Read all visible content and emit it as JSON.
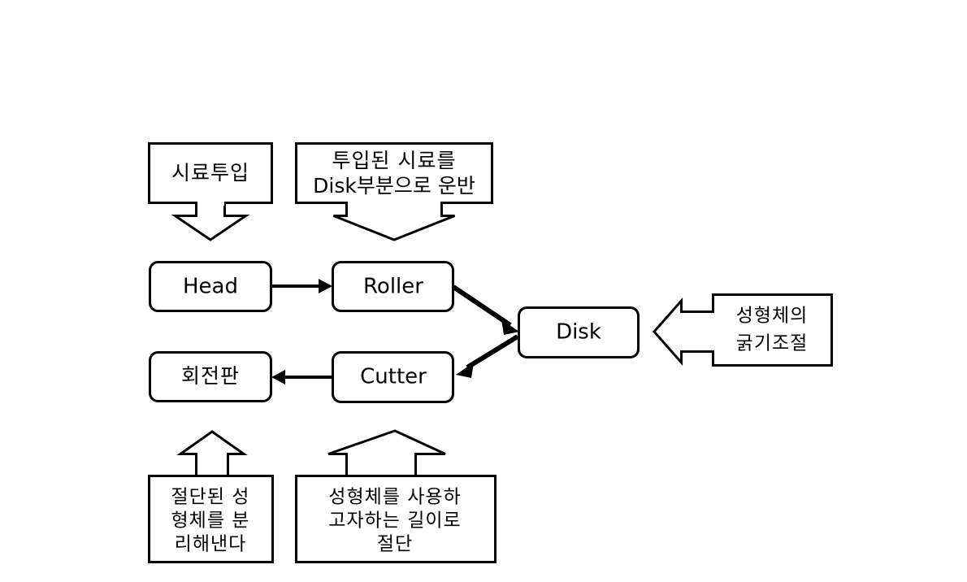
{
  "diagram": {
    "title": "",
    "background_color": "#ffffff",
    "stroke_color": "#000000",
    "nodes": {
      "sample_input": {
        "label": "시료투입"
      },
      "transport": {
        "line1": "투입된 시료를",
        "line2": "Disk부분으로 운반"
      },
      "head": {
        "label": "Head"
      },
      "roller": {
        "label": "Roller"
      },
      "disk": {
        "label": "Disk"
      },
      "cutter": {
        "label": "Cutter"
      },
      "rotating_plate": {
        "label": "회전판"
      },
      "thickness_note": {
        "line1": "성형체의",
        "line2": "굵기조절"
      },
      "separate_note": {
        "line1": "절단된 성",
        "line2": "형체를 분",
        "line3": "리해낸다"
      },
      "cut_note": {
        "line1": "성형체를 사용하",
        "line2": "고자하는 길이로",
        "line3": "절단"
      }
    },
    "connectors": {
      "sample_input_down": "down-block-arrow",
      "transport_down": "down-block-arrow",
      "head_to_roller": "right-line-arrow",
      "roller_to_disk": "diagonal-line-arrow",
      "disk_to_cutter": "diagonal-line-arrow",
      "cutter_to_rotating_plate": "left-line-arrow",
      "thickness_to_disk": "left-block-arrow",
      "separate_note_up": "up-block-arrow",
      "cut_note_up": "up-block-arrow"
    }
  }
}
